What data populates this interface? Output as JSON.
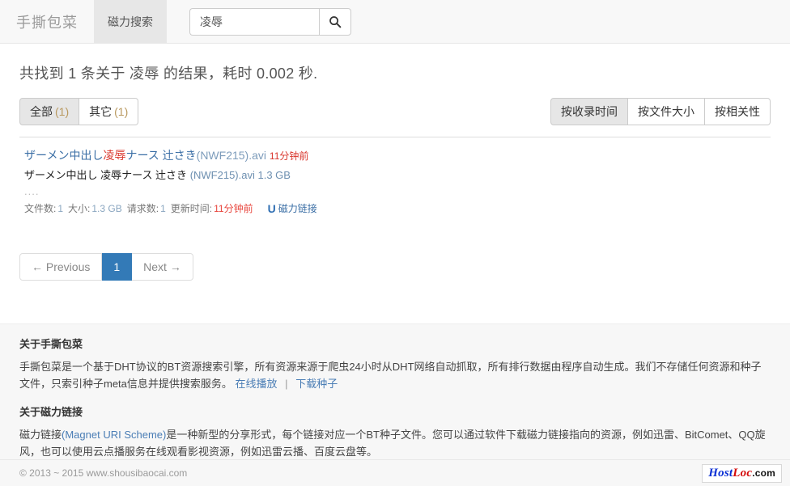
{
  "header": {
    "brand": "手撕包菜",
    "nav_tab": "磁力搜索",
    "search_value": "凌辱",
    "search_placeholder": "",
    "search_icon": "search-icon"
  },
  "results_page": {
    "summary": "共找到 1 条关于 凌辱 的结果，耗时 0.002 秒.",
    "filters": [
      {
        "label": "全部",
        "count": "(1)",
        "active": true
      },
      {
        "label": "其它",
        "count": "(1)",
        "active": false
      }
    ],
    "sorts": [
      {
        "label": "按收录时间",
        "active": true
      },
      {
        "label": "按文件大小",
        "active": false
      },
      {
        "label": "按相关性",
        "active": false
      }
    ],
    "items": [
      {
        "title_pre": "ザーメン中出し",
        "title_hl": "凌辱",
        "title_mid": "ナース 辻さき",
        "title_dim": "(NWF215).avi",
        "title_time": "11分钟前",
        "subtitle": "ザーメン中出し 凌辱ナース 辻さき",
        "subtitle_dim": "(NWF215).avi 1.3 GB",
        "dots": "....",
        "meta": {
          "files_label": "文件数:",
          "files_value": "1",
          "size_label": "大小:",
          "size_value": "1.3 GB",
          "requests_label": "请求数:",
          "requests_value": "1",
          "updated_label": "更新时间:",
          "updated_value": "11分钟前",
          "magnet_icon": "magnet-icon",
          "magnet_label": "磁力链接"
        }
      }
    ],
    "pagination": {
      "previous": "← Previous",
      "current": "1",
      "next": "Next →"
    }
  },
  "footer": {
    "about_title": "关于手撕包菜",
    "about_text": "手撕包菜是一个基于DHT协议的BT资源搜索引擎，所有资源来源于爬虫24小时从DHT网络自动抓取，所有排行数据由程序自动生成。我们不存储任何资源和种子文件，只索引种子meta信息并提供搜索服务。",
    "about_link_1": "在线播放",
    "about_link_sep": "|",
    "about_link_2": "下载种子",
    "magnet_title": "关于磁力链接",
    "magnet_text_pre": "磁力链接",
    "magnet_scheme_link": "(Magnet URI Scheme)",
    "magnet_text_post": "是一种新型的分享形式，每个链接对应一个BT种子文件。您可以通过软件下载磁力链接指向的资源，例如迅雷、BitComet、QQ旋风，也可以使用云点播服务在线观看影视资源，例如迅雷云播、百度云盘等。",
    "copyright": "© 2013 ~ 2015 www.shousibaocai.com",
    "badge": {
      "part1": "Host",
      "part2": "Loc",
      "part3": ".com"
    }
  }
}
